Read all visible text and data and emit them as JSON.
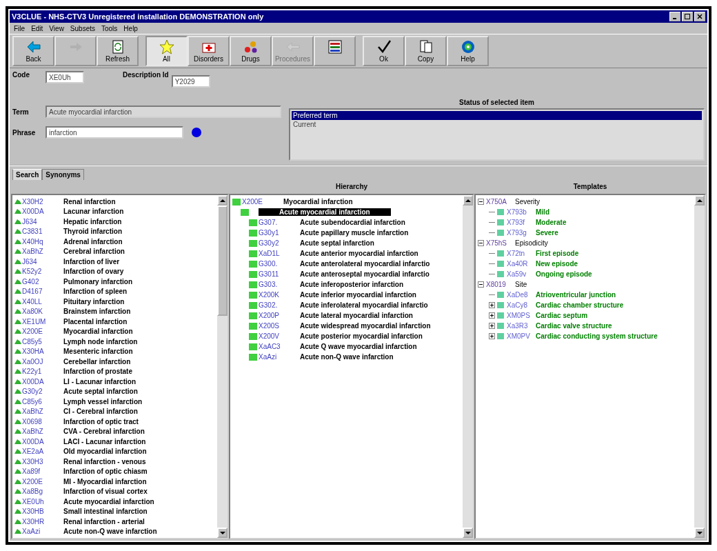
{
  "window": {
    "title": "V3CLUE - NHS-CTV3 Unregistered installation DEMONSTRATION only"
  },
  "menu": [
    "File",
    "Edit",
    "View",
    "Subsets",
    "Tools",
    "Help"
  ],
  "toolbar_groups": [
    {
      "buttons": [
        {
          "kind": "back",
          "label": "Back",
          "selected": false,
          "disabled": false
        },
        {
          "kind": "forward",
          "selected": false,
          "disabled": true
        },
        {
          "kind": "refresh",
          "label": "Refresh",
          "selected": false,
          "disabled": false
        }
      ]
    },
    {
      "buttons": [
        {
          "kind": "star",
          "label": "All",
          "selected": true,
          "disabled": false
        },
        {
          "kind": "disorders",
          "label": "Disorders",
          "selected": false,
          "disabled": false
        },
        {
          "kind": "drugs",
          "label": "Drugs",
          "selected": false,
          "disabled": false
        },
        {
          "kind": "procedures",
          "label": "Procedures",
          "selected": false,
          "disabled": true
        },
        {
          "kind": "list",
          "selected": false,
          "disabled": false
        }
      ]
    },
    {
      "buttons": [
        {
          "kind": "ok",
          "label": "Ok",
          "selected": false,
          "disabled": false
        },
        {
          "kind": "copy",
          "label": "Copy",
          "selected": false,
          "disabled": false
        },
        {
          "kind": "help",
          "label": "Help",
          "selected": false,
          "disabled": false
        }
      ]
    }
  ],
  "form": {
    "code_label": "Code",
    "code": "XE0Uh",
    "description_id_label": "Description Id",
    "description_id": "Y2029",
    "term_label": "Term",
    "term": "Acute myocardial infarction",
    "phrase_label": "Phrase",
    "phrase": "infarction"
  },
  "status": {
    "title": "Status of selected item",
    "items": [
      {
        "label": "Preferred term",
        "selected": true
      },
      {
        "label": "Current",
        "selected": false
      }
    ]
  },
  "tabs": [
    {
      "label": "Search",
      "selected": true
    },
    {
      "label": "Synonyms",
      "selected": false
    }
  ],
  "search_results": [
    {
      "code": "X30H2",
      "term": "Renal infarction"
    },
    {
      "code": "X00DA",
      "term": "Lacunar infarction"
    },
    {
      "code": "J634",
      "term": "Hepatic infarction"
    },
    {
      "code": "C3831",
      "term": "Thyroid infarction"
    },
    {
      "code": "X40Hq",
      "term": "Adrenal infarction"
    },
    {
      "code": "XaBhZ",
      "term": "Cerebral infarction"
    },
    {
      "code": "J634",
      "term": "Infarction of liver"
    },
    {
      "code": "K52y2",
      "term": "Infarction of ovary"
    },
    {
      "code": "G402",
      "term": "Pulmonary infarction"
    },
    {
      "code": "D4167",
      "term": "Infarction of spleen"
    },
    {
      "code": "X40LL",
      "term": "Pituitary infarction"
    },
    {
      "code": "Xa80K",
      "term": "Brainstem infarction"
    },
    {
      "code": "XE1UM",
      "term": "Placental infarction"
    },
    {
      "code": "X200E",
      "term": "Myocardial infarction"
    },
    {
      "code": "C85y5",
      "term": "Lymph node infarction"
    },
    {
      "code": "X30HA",
      "term": "Mesenteric infarction"
    },
    {
      "code": "Xa0OJ",
      "term": "Cerebellar infarction"
    },
    {
      "code": "K22y1",
      "term": "Infarction of prostate"
    },
    {
      "code": "X00DA",
      "term": "LI - Lacunar infarction"
    },
    {
      "code": "G30y2",
      "term": "Acute septal infarction"
    },
    {
      "code": "C85y6",
      "term": "Lymph vessel infarction"
    },
    {
      "code": "XaBhZ",
      "term": "CI - Cerebral infarction"
    },
    {
      "code": "X0698",
      "term": "Infarction of optic tract"
    },
    {
      "code": "XaBhZ",
      "term": "CVA - Cerebral infarction"
    },
    {
      "code": "X00DA",
      "term": "LACI - Lacunar infarction"
    },
    {
      "code": "XE2aA",
      "term": "Old myocardial infarction"
    },
    {
      "code": "X30H3",
      "term": "Renal infarction - venous"
    },
    {
      "code": "Xa89f",
      "term": "Infarction of optic chiasm"
    },
    {
      "code": "X200E",
      "term": "MI - Myocardial infarction"
    },
    {
      "code": "Xa8Bg",
      "term": "Infarction of visual cortex"
    },
    {
      "code": "XE0Uh",
      "term": "Acute myocardial infarction"
    },
    {
      "code": "X30HB",
      "term": "Small intestinal infarction"
    },
    {
      "code": "X30HR",
      "term": "Renal infarction - arterial"
    },
    {
      "code": "XaAzi",
      "term": "Acute non-Q wave infarction"
    }
  ],
  "hierarchy": {
    "title": "Hierarchy",
    "nodes": [
      {
        "code": "X200E",
        "term": "Myocardial infarction",
        "selected": false,
        "children": [
          {
            "term": "Acute myocardial infarction",
            "selected": true,
            "children": [
              {
                "code": "G307.",
                "term": "Acute subendocardial infarction",
                "selected": false
              },
              {
                "code": "G30y1",
                "term": "Acute papillary muscle infarction",
                "selected": false
              },
              {
                "code": "G30y2",
                "term": "Acute septal infarction",
                "selected": false
              },
              {
                "code": "XaD1L",
                "term": "Acute anterior myocardial infarction",
                "selected": false
              },
              {
                "code": "G300.",
                "term": "Acute anterolateral myocardial infarctio",
                "selected": false
              },
              {
                "code": "G3011",
                "term": "Acute anteroseptal myocardial infarctio",
                "selected": false
              },
              {
                "code": "G303.",
                "term": "Acute inferoposterior infarction",
                "selected": false
              },
              {
                "code": "X200K",
                "term": "Acute inferior myocardial infarction",
                "selected": false
              },
              {
                "code": "G302.",
                "term": "Acute inferolateral myocardial infarctio",
                "selected": false
              },
              {
                "code": "X200P",
                "term": "Acute lateral myocardial infarction",
                "selected": false
              },
              {
                "code": "X200S",
                "term": "Acute widespread myocardial infarction",
                "selected": false
              },
              {
                "code": "X200V",
                "term": "Acute posterior myocardial infarction",
                "selected": false
              },
              {
                "code": "XaAC3",
                "term": "Acute Q wave myocardial infarction",
                "selected": false
              },
              {
                "code": "XaAzi",
                "term": "Acute non-Q wave infarction",
                "selected": false
              }
            ]
          }
        ]
      }
    ]
  },
  "templates": {
    "title": "Templates",
    "nodes": [
      {
        "code": "X750A",
        "term": "Severity",
        "expanded": true,
        "children": [
          {
            "code": "X793b",
            "term": "Mild"
          },
          {
            "code": "X793f",
            "term": "Moderate"
          },
          {
            "code": "X793g",
            "term": "Severe"
          }
        ]
      },
      {
        "code": "X75hS",
        "term": "Episodicity",
        "expanded": true,
        "children": [
          {
            "code": "X72tn",
            "term": "First episode"
          },
          {
            "code": "Xa40R",
            "term": "New episode"
          },
          {
            "code": "Xa59v",
            "term": "Ongoing episode"
          }
        ]
      },
      {
        "code": "X8019",
        "term": "Site",
        "expanded": true,
        "children": [
          {
            "code": "XaDe8",
            "term": "Atrioventricular junction"
          },
          {
            "code": "XaCy8",
            "term": "Cardiac chamber structure",
            "expanded": false
          },
          {
            "code": "XM0PS",
            "term": "Cardiac septum",
            "expanded": false
          },
          {
            "code": "Xa3R3",
            "term": "Cardiac valve structure",
            "expanded": false
          },
          {
            "code": "XM0PV",
            "term": "Cardiac conducting system structure",
            "expanded": false
          }
        ]
      }
    ]
  }
}
